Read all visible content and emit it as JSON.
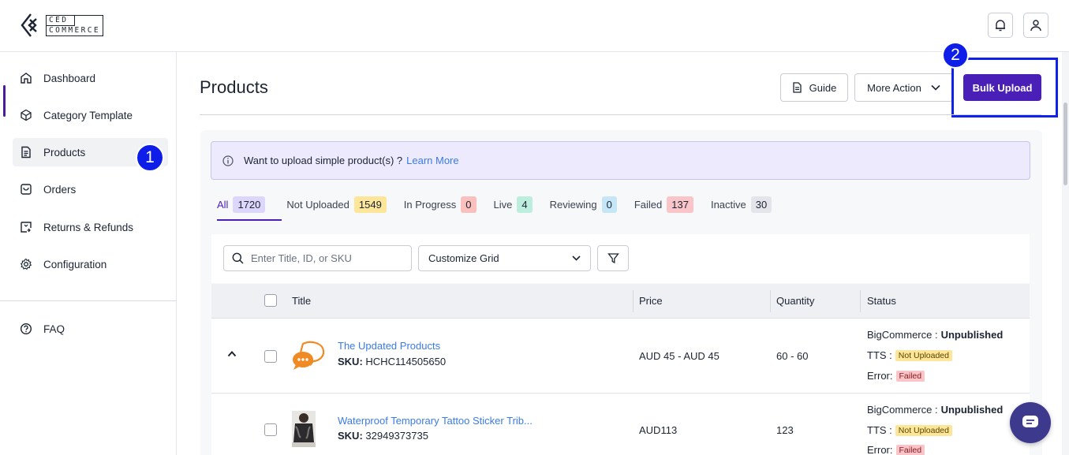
{
  "logo": {
    "line1": "CED",
    "line2": "COMMERCE"
  },
  "sidebar": {
    "items": [
      {
        "label": "Dashboard",
        "icon": "home-icon"
      },
      {
        "label": "Category Template",
        "icon": "cube-icon"
      },
      {
        "label": "Products",
        "icon": "document-icon",
        "active": true
      },
      {
        "label": "Orders",
        "icon": "box-icon"
      },
      {
        "label": "Returns & Refunds",
        "icon": "return-icon"
      },
      {
        "label": "Configuration",
        "icon": "gear-icon"
      }
    ],
    "faq": {
      "label": "FAQ",
      "icon": "question-icon"
    }
  },
  "annotations": {
    "step1": "1",
    "step2": "2"
  },
  "header": {
    "title": "Products",
    "guide_label": "Guide",
    "more_action_label": "More Action",
    "bulk_upload_label": "Bulk Upload"
  },
  "info_banner": {
    "text": "Want to upload simple product(s) ?",
    "link": "Learn More"
  },
  "tabs": [
    {
      "label": "All",
      "count": "1720",
      "color": "#ddd6fb"
    },
    {
      "label": "Not Uploaded",
      "count": "1549",
      "color": "#fde69a"
    },
    {
      "label": "In Progress",
      "count": "0",
      "color": "#f9c0bd"
    },
    {
      "label": "Live",
      "count": "4",
      "color": "#bdeedd"
    },
    {
      "label": "Reviewing",
      "count": "0",
      "color": "#c5e6f7"
    },
    {
      "label": "Failed",
      "count": "137",
      "color": "#f9c5c8"
    },
    {
      "label": "Inactive",
      "count": "30",
      "color": "#e3e5ea"
    }
  ],
  "toolbar": {
    "search_placeholder": "Enter Title, ID, or SKU",
    "grid_select": "Customize Grid"
  },
  "table": {
    "columns": [
      "Title",
      "Price",
      "Quantity",
      "Status"
    ],
    "rows": [
      {
        "title": "The Updated Products",
        "sku_label": "SKU:",
        "sku": "HCHC114505650",
        "price": "AUD 45 - AUD 45",
        "quantity": "60 - 60",
        "bc_label": "BigCommerce :",
        "bc_status": "Unpublished",
        "tts_label": "TTS :",
        "tts_status": "Not Uploaded",
        "error_label": "Error:",
        "error_status": "Failed"
      },
      {
        "title": "Waterproof Temporary Tattoo Sticker Trib...",
        "sku_label": "SKU:",
        "sku": "32949373735",
        "price": "AUD113",
        "quantity": "123",
        "bc_label": "BigCommerce :",
        "bc_status": "Unpublished",
        "tts_label": "TTS :",
        "tts_status": "Not Uploaded",
        "error_label": "Error:",
        "error_status": "Failed"
      }
    ]
  },
  "colors": {
    "accent": "#4a1fb8",
    "annotation": "#0e1ee8",
    "link": "#3b7be8"
  }
}
